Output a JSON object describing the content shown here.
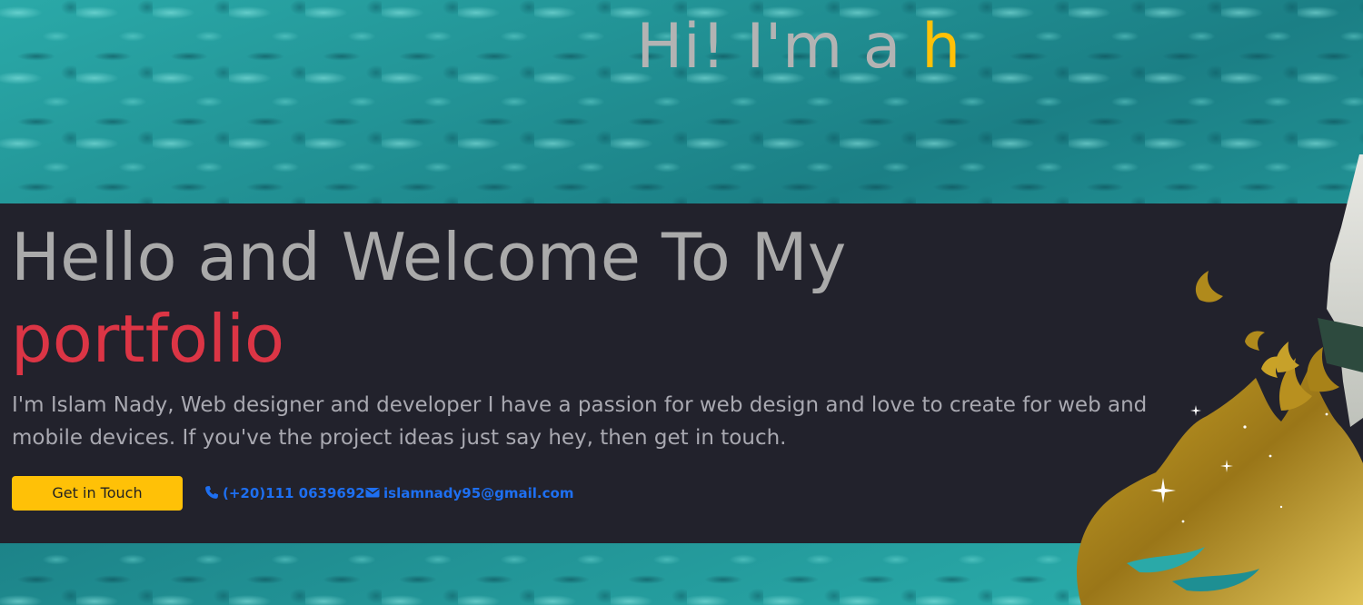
{
  "hero": {
    "title_static": "Hi! I'm a ",
    "title_typed": "h"
  },
  "intro": {
    "heading_line1": "Hello and Welcome To My",
    "heading_line2": "portfolio",
    "description": "I'm Islam Nady, Web designer and developer I have a passion for web design and love to create for web and mobile devices. If you've the project ideas just say hey, then get in touch.",
    "cta_label": "Get in Touch",
    "phone_icon": "phone-icon",
    "phone": "(+20)111 0639692",
    "email_icon": "envelope-icon",
    "email": "islamnady95@gmail.com"
  },
  "colors": {
    "accent_yellow": "#ffc107",
    "accent_red": "#dc3545",
    "link_blue": "#1e6ff0",
    "band_dark": "#22222c",
    "water_teal": "#1e8f93"
  }
}
